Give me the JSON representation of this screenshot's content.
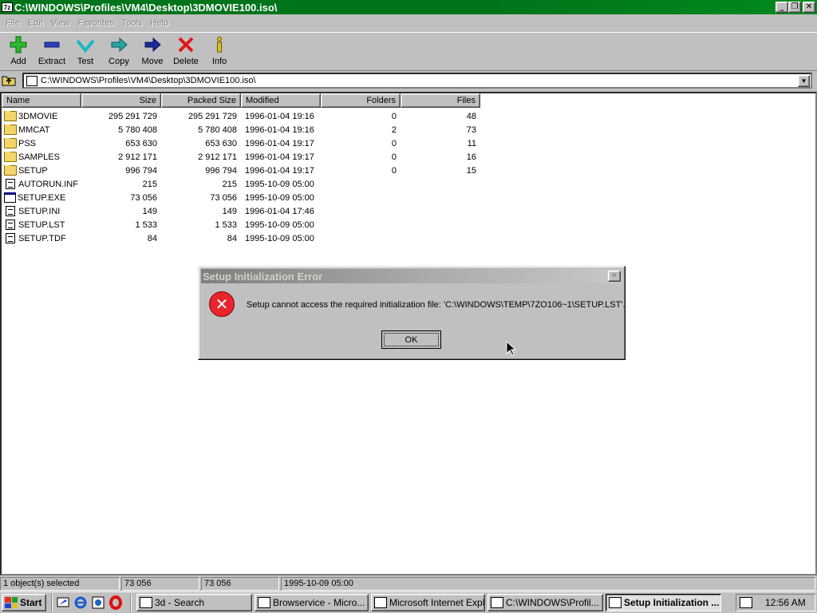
{
  "window": {
    "title": "C:\\WINDOWS\\Profiles\\VM4\\Desktop\\3DMOVIE100.iso\\",
    "icon_text": "7z",
    "min_label": "_",
    "max_label": "❐",
    "close_label": "✕"
  },
  "menu": [
    "File",
    "Edit",
    "View",
    "Favorites",
    "Tools",
    "Help"
  ],
  "toolbar": [
    {
      "label": "Add",
      "icon": "add-icon"
    },
    {
      "label": "Extract",
      "icon": "extract-icon"
    },
    {
      "label": "Test",
      "icon": "test-icon"
    },
    {
      "label": "Copy",
      "icon": "copy-icon"
    },
    {
      "label": "Move",
      "icon": "move-icon"
    },
    {
      "label": "Delete",
      "icon": "delete-icon"
    },
    {
      "label": "Info",
      "icon": "info-icon"
    }
  ],
  "address": {
    "path": "C:\\WINDOWS\\Profiles\\VM4\\Desktop\\3DMOVIE100.iso\\",
    "dropdown": "▼"
  },
  "columns": [
    "Name",
    "Size",
    "Packed Size",
    "Modified",
    "Folders",
    "Files"
  ],
  "files": [
    {
      "name": "3DMOVIE",
      "type": "folder",
      "size": "295 291 729",
      "packed": "295 291 729",
      "modified": "1996-01-04 19:16",
      "folders": "0",
      "files": "48"
    },
    {
      "name": "MMCAT",
      "type": "folder",
      "size": "5 780 408",
      "packed": "5 780 408",
      "modified": "1996-01-04 19:16",
      "folders": "2",
      "files": "73"
    },
    {
      "name": "PSS",
      "type": "folder",
      "size": "653 630",
      "packed": "653 630",
      "modified": "1996-01-04 19:17",
      "folders": "0",
      "files": "11"
    },
    {
      "name": "SAMPLES",
      "type": "folder",
      "size": "2 912 171",
      "packed": "2 912 171",
      "modified": "1996-01-04 19:17",
      "folders": "0",
      "files": "16"
    },
    {
      "name": "SETUP",
      "type": "folder",
      "size": "996 794",
      "packed": "996 794",
      "modified": "1996-01-04 19:17",
      "folders": "0",
      "files": "15"
    },
    {
      "name": "AUTORUN.INF",
      "type": "doc",
      "size": "215",
      "packed": "215",
      "modified": "1995-10-09 05:00",
      "folders": "",
      "files": ""
    },
    {
      "name": "SETUP.EXE",
      "type": "exe",
      "size": "73 056",
      "packed": "73 056",
      "modified": "1995-10-09 05:00",
      "folders": "",
      "files": ""
    },
    {
      "name": "SETUP.INI",
      "type": "doc",
      "size": "149",
      "packed": "149",
      "modified": "1996-01-04 17:46",
      "folders": "",
      "files": ""
    },
    {
      "name": "SETUP.LST",
      "type": "doc",
      "size": "1 533",
      "packed": "1 533",
      "modified": "1995-10-09 05:00",
      "folders": "",
      "files": ""
    },
    {
      "name": "SETUP.TDF",
      "type": "doc",
      "size": "84",
      "packed": "84",
      "modified": "1995-10-09 05:00",
      "folders": "",
      "files": ""
    }
  ],
  "dialog": {
    "title": "Setup Initialization Error",
    "message": "Setup cannot access the required initialization file: 'C:\\WINDOWS\\TEMP\\7ZO106~1\\SETUP.LST'.",
    "ok_label": "OK",
    "close_label": "✕",
    "icon": "error-icon",
    "icon_glyph": "✕"
  },
  "status": {
    "selected": "1 object(s) selected",
    "size": "73 056",
    "packed": "73 056",
    "modified": "1995-10-09 05:00"
  },
  "taskbar": {
    "start_label": "Start",
    "tasks": [
      {
        "label": "3d - Search",
        "active": false
      },
      {
        "label": "Browservice - Micro...",
        "active": false
      },
      {
        "label": "Microsoft Internet Expl...",
        "active": false
      },
      {
        "label": "C:\\WINDOWS\\Profil...",
        "active": false
      },
      {
        "label": "Setup Initialization ...",
        "active": true
      }
    ],
    "clock": "12:56 AM"
  },
  "colors": {
    "title_green": "#00741a",
    "error_red": "#e8242c",
    "dialog_title_gray": "#808080"
  }
}
